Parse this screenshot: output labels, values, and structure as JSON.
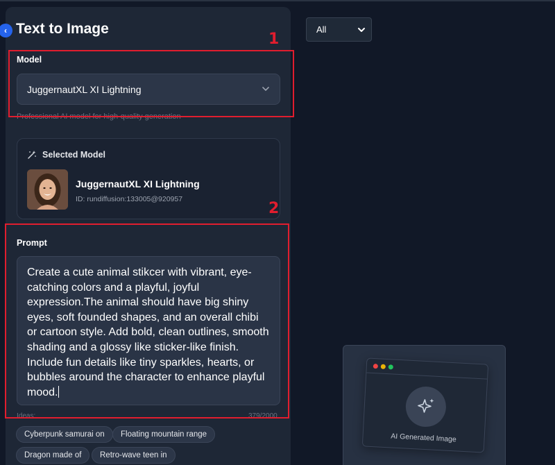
{
  "header": {
    "title": "Text to Image"
  },
  "model_section": {
    "label": "Model",
    "selected_value": "JuggernautXL XI Lightning",
    "helper_text": "Professional AI model for high-quality generation"
  },
  "selected_model_card": {
    "heading": "Selected Model",
    "name": "JuggernautXL XI Lightning",
    "id_text": "ID: rundiffusion:133005@920957",
    "avatar_icon": "portrait-photo"
  },
  "prompt_section": {
    "label": "Prompt",
    "value": "Create a cute animal stikcer with vibrant, eye-catching colors and a playful, joyful expression.The animal should have big shiny eyes, soft founded shapes, and an overall chibi or cartoon style. Add bold, clean outlines, smooth shading and a glossy like sticker-like finish. Include fun details like tiny sparkles, hearts, or bubbles around the character to enhance playful mood.",
    "ideas_label": "Ideas:",
    "char_count": "379/2000"
  },
  "idea_chips": [
    "Cyberpunk samurai on",
    "Floating mountain range",
    "Dragon made of",
    "Retro-wave teen in"
  ],
  "annotations": {
    "box1": "1",
    "box2": "2",
    "color": "#e11d2e"
  },
  "filter": {
    "selected": "All"
  },
  "preview": {
    "caption": "AI Generated Image",
    "icon": "sparkles-icon"
  },
  "colors": {
    "accent": "#2563eb",
    "panel": "#1e2736",
    "background": "#111827"
  }
}
